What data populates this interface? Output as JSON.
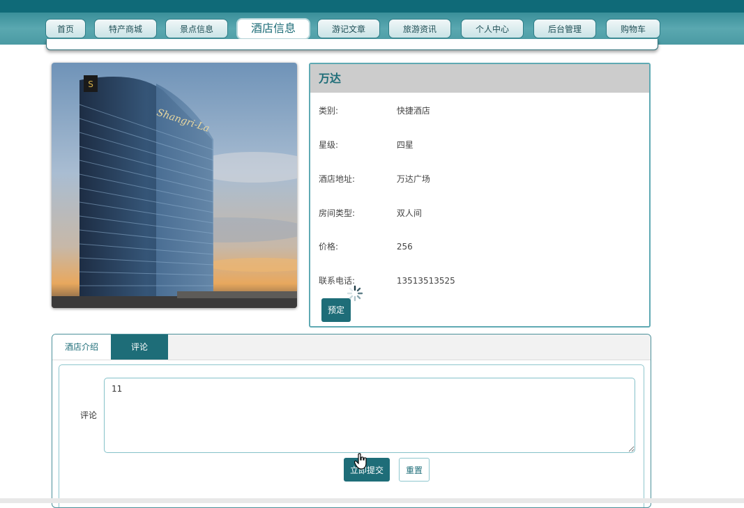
{
  "nav": {
    "items": [
      "首页",
      "特产商城",
      "景点信息",
      "酒店信息",
      "游记文章",
      "旅游资讯",
      "个人中心",
      "后台管理",
      "购物车"
    ],
    "active_index": 3
  },
  "hotel": {
    "name": "万达",
    "image_sign_text": "Shangri-La",
    "fields": [
      {
        "label": "类别:",
        "value": "快捷酒店"
      },
      {
        "label": "星级:",
        "value": "四星"
      },
      {
        "label": "酒店地址:",
        "value": "万达广场"
      },
      {
        "label": "房间类型:",
        "value": "双人间"
      },
      {
        "label": "价格:",
        "value": "256"
      },
      {
        "label": "联系电话:",
        "value": "13513513525"
      }
    ],
    "book_label": "预定"
  },
  "tabs": {
    "intro_label": "酒店介绍",
    "comment_label": "评论",
    "active": "comment"
  },
  "comment": {
    "label": "评论",
    "value": "11",
    "submit_label": "立即提交",
    "reset_label": "重置"
  },
  "colors": {
    "primary": "#1e6d78",
    "nav_bg": "#4a9aa3",
    "panel_border": "#5fa9b3",
    "header_bg": "#cccccc"
  }
}
